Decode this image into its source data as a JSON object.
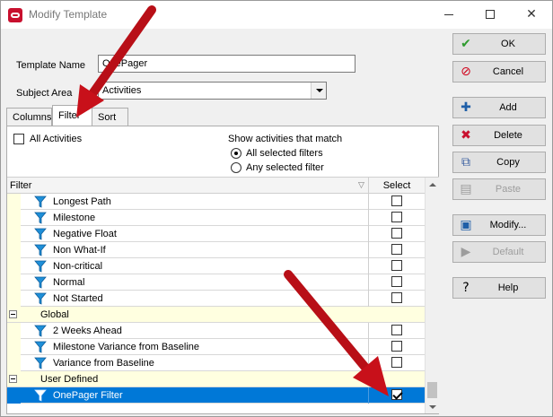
{
  "window": {
    "title": "Modify Template",
    "controls": {
      "minimize": "minimize",
      "maximize": "maximize",
      "close": "✕"
    }
  },
  "form": {
    "template_name_label": "Template Name",
    "template_name_value": "OnePager",
    "subject_area_label": "Subject Area",
    "subject_area_value": "Activities"
  },
  "tabs": [
    {
      "label": "Columns",
      "active": false
    },
    {
      "label": "Filter",
      "active": true
    },
    {
      "label": "Sort",
      "active": false
    }
  ],
  "filter_panel": {
    "all_activities_label": "All Activities",
    "all_activities_checked": false,
    "match_heading": "Show activities that match",
    "match_options": [
      {
        "label": "All selected filters",
        "selected": true
      },
      {
        "label": "Any selected filter",
        "selected": false
      }
    ]
  },
  "grid": {
    "columns": {
      "filter": "Filter",
      "select": "Select"
    },
    "rows": [
      {
        "type": "item",
        "name": "Longest Path",
        "checked": false,
        "selected": false
      },
      {
        "type": "item",
        "name": "Milestone",
        "checked": false,
        "selected": false
      },
      {
        "type": "item",
        "name": "Negative Float",
        "checked": false,
        "selected": false
      },
      {
        "type": "item",
        "name": "Non What-If",
        "checked": false,
        "selected": false
      },
      {
        "type": "item",
        "name": "Non-critical",
        "checked": false,
        "selected": false
      },
      {
        "type": "item",
        "name": "Normal",
        "checked": false,
        "selected": false
      },
      {
        "type": "item",
        "name": "Not Started",
        "checked": false,
        "selected": false
      },
      {
        "type": "group",
        "name": "Global"
      },
      {
        "type": "item",
        "name": "2 Weeks Ahead",
        "checked": false,
        "selected": false
      },
      {
        "type": "item",
        "name": "Milestone Variance from Baseline",
        "checked": false,
        "selected": false
      },
      {
        "type": "item",
        "name": "Variance from Baseline",
        "checked": false,
        "selected": false
      },
      {
        "type": "group",
        "name": "User Defined"
      },
      {
        "type": "item",
        "name": "OnePager Filter",
        "checked": true,
        "selected": true
      }
    ]
  },
  "buttons": [
    {
      "label": "OK",
      "icon": "check-icon",
      "glyph": "✔",
      "color": "#2e9b2e",
      "enabled": true
    },
    {
      "label": "Cancel",
      "icon": "cancel-icon",
      "glyph": "⊘",
      "color": "#d0021b",
      "enabled": true
    },
    {
      "label": "Add",
      "icon": "add-icon",
      "glyph": "✚",
      "color": "#1f5fa8",
      "enabled": true
    },
    {
      "label": "Delete",
      "icon": "delete-icon",
      "glyph": "✖",
      "color": "#c8102e",
      "enabled": true
    },
    {
      "label": "Copy",
      "icon": "copy-icon",
      "glyph": "⧉",
      "color": "#3a5fa0",
      "enabled": true
    },
    {
      "label": "Paste",
      "icon": "paste-icon",
      "glyph": "▤",
      "color": "#9d9d9d",
      "enabled": false
    },
    {
      "label": "Modify...",
      "icon": "modify-icon",
      "glyph": "▣",
      "color": "#1f5fa8",
      "enabled": true
    },
    {
      "label": "Default",
      "icon": "default-icon",
      "glyph": "▶",
      "color": "#9d9d9d",
      "enabled": false
    },
    {
      "label": "Help",
      "icon": "help-icon",
      "glyph": "?",
      "color": "#000000",
      "enabled": true
    }
  ],
  "colors": {
    "selection": "#0078d7",
    "group_row": "#ffffe0",
    "filter_icon": "#1e8fd8",
    "annotation_arrow": "#c8101a"
  }
}
